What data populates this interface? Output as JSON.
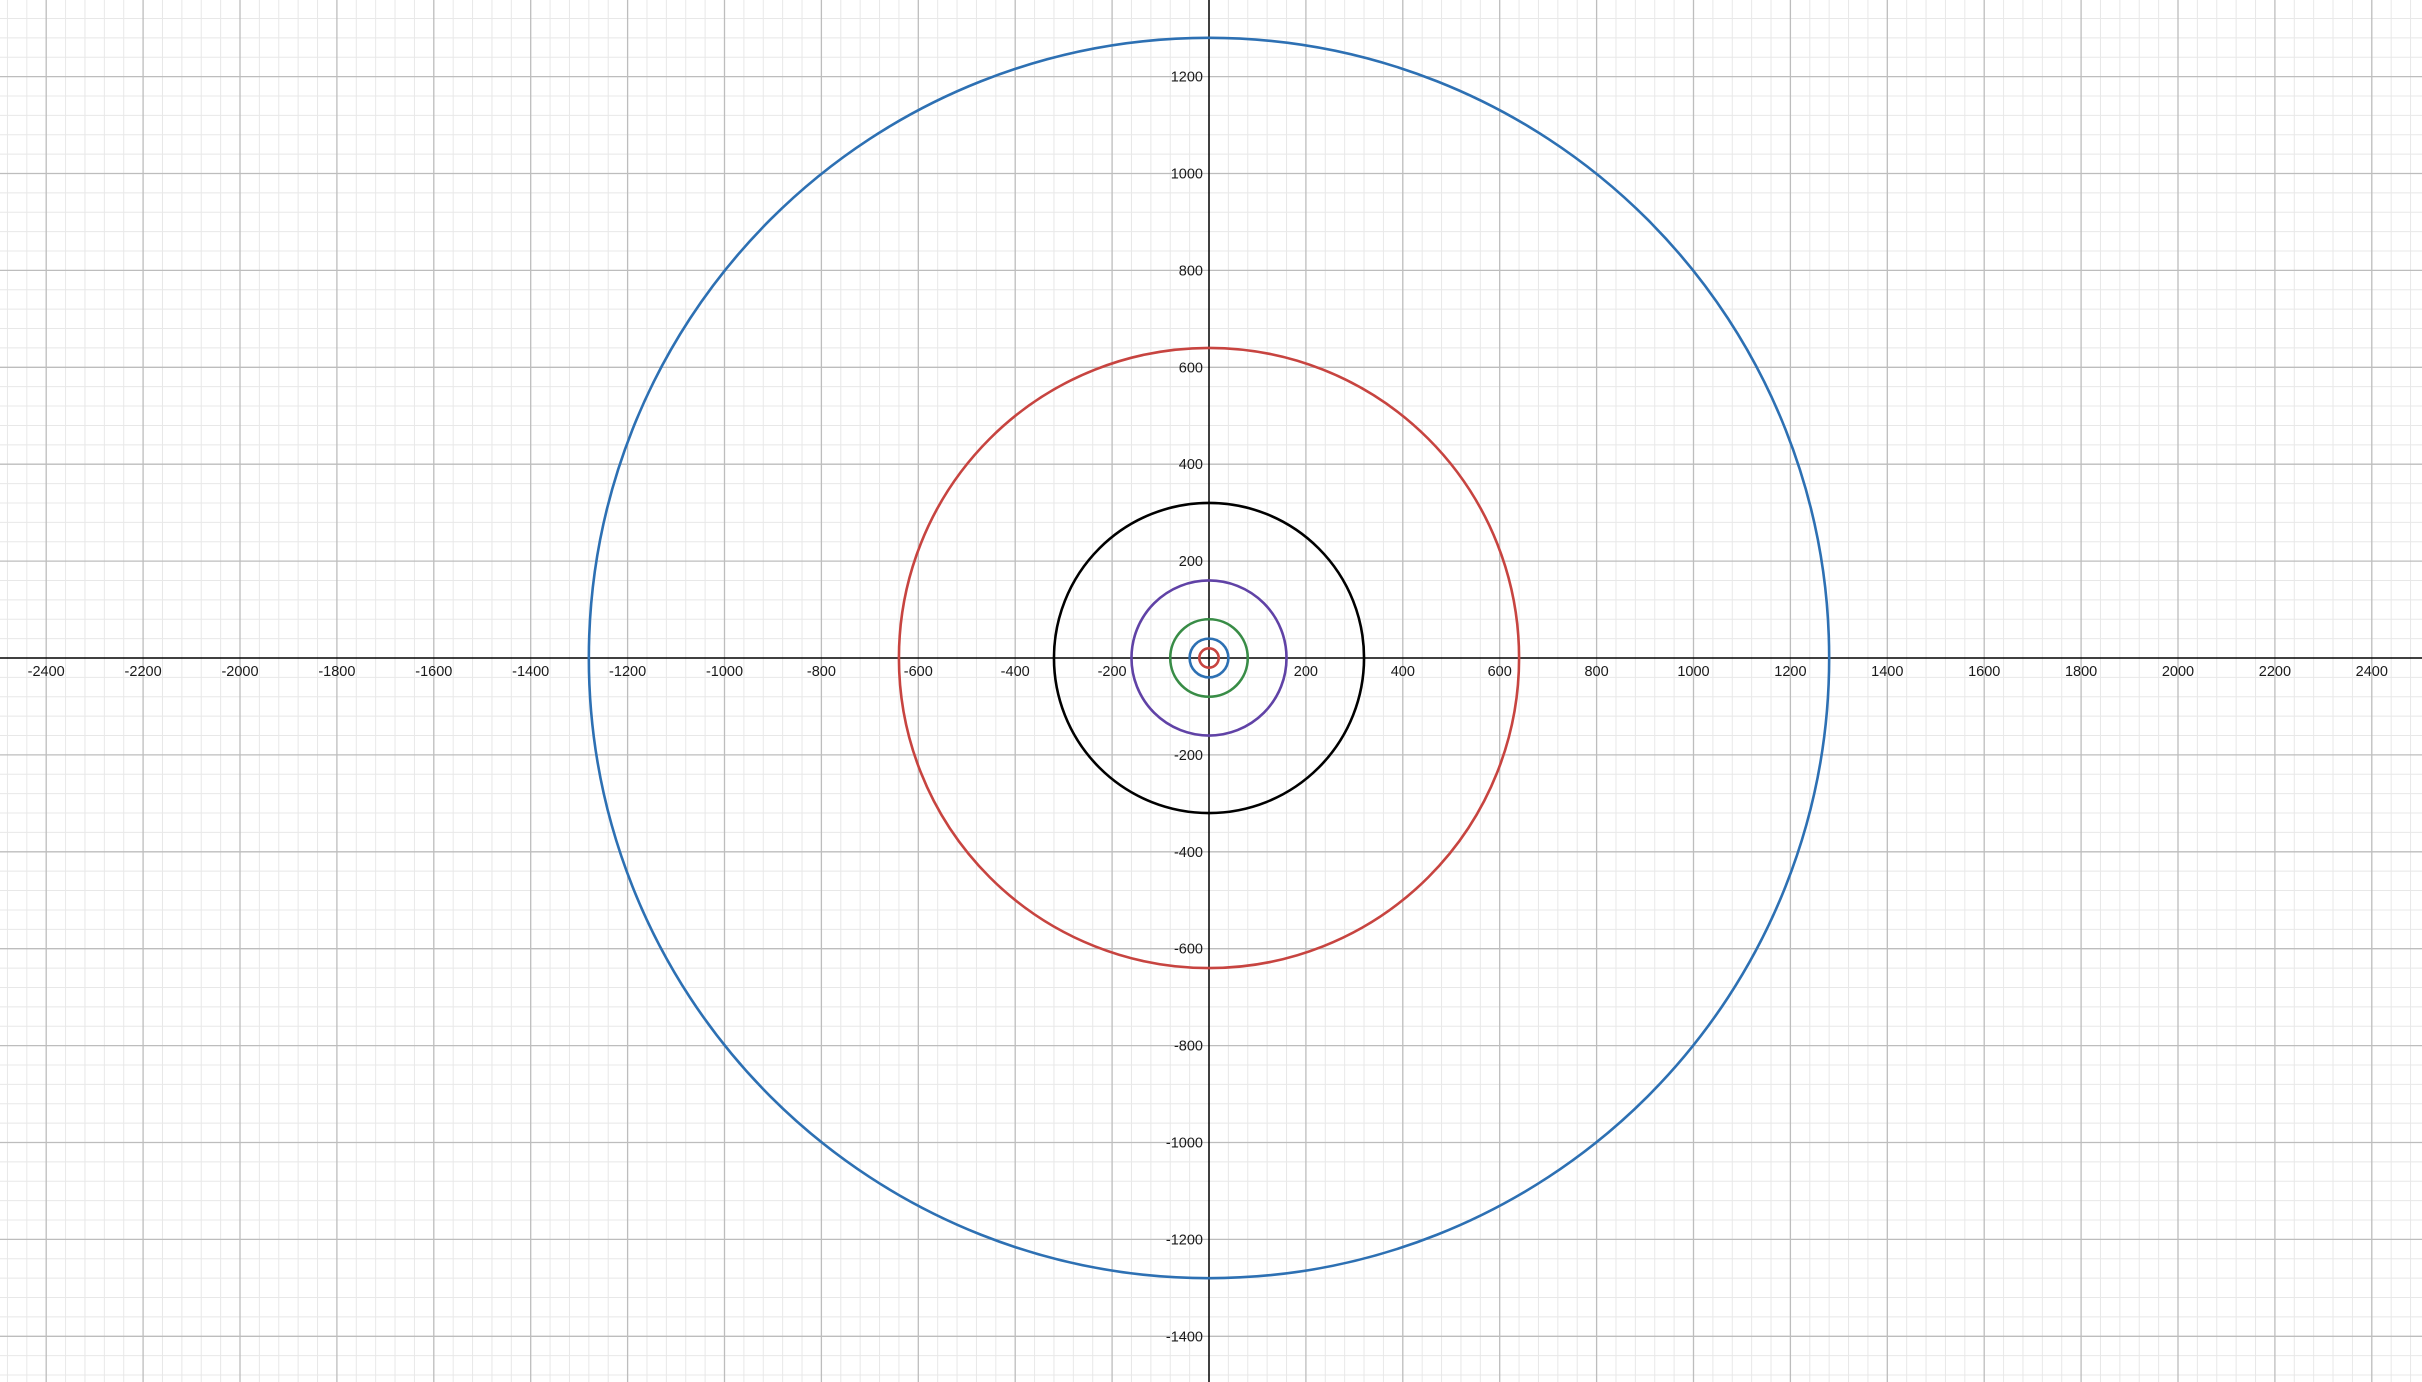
{
  "chart_data": {
    "type": "scatter",
    "title": "",
    "xlabel": "",
    "ylabel": "",
    "xlim": [
      -2500,
      2500
    ],
    "ylim": [
      -1490,
      1360
    ],
    "grid": true,
    "minor_grid": true,
    "legend": "none",
    "x_ticks": [
      -2400,
      -2200,
      -2000,
      -1800,
      -1600,
      -1400,
      -1200,
      -1000,
      -800,
      -600,
      -400,
      -200,
      200,
      400,
      600,
      800,
      1000,
      1200,
      1400,
      1600,
      1800,
      2000,
      2200,
      2400
    ],
    "x_tick_labels": [
      "-2400",
      "-2200",
      "-2000",
      "-1800",
      "-1600",
      "-1400",
      "-1200",
      "-1000",
      "-800",
      "-600",
      "-400",
      "-200",
      "200",
      "400",
      "600",
      "800",
      "1000",
      "1200",
      "1400",
      "1600",
      "1800",
      "2000",
      "2200",
      "2400"
    ],
    "y_ticks": [
      1200,
      1000,
      800,
      600,
      400,
      200,
      -200,
      -400,
      -600,
      -800,
      -1000,
      -1200,
      -1400
    ],
    "y_tick_labels": [
      "1200",
      "1000",
      "800",
      "600",
      "400",
      "200",
      "-200",
      "-400",
      "-600",
      "-800",
      "-1000",
      "-1200",
      "-1400"
    ],
    "circles": [
      {
        "cx": 0,
        "cy": 0,
        "r": 1280,
        "color": "#2d70b3"
      },
      {
        "cx": 0,
        "cy": 0,
        "r": 640,
        "color": "#c74440"
      },
      {
        "cx": 0,
        "cy": 0,
        "r": 320,
        "color": "#000000"
      },
      {
        "cx": 0,
        "cy": 0,
        "r": 160,
        "color": "#6042a6"
      },
      {
        "cx": 0,
        "cy": 0,
        "r": 80,
        "color": "#388c46"
      },
      {
        "cx": 0,
        "cy": 0,
        "r": 40,
        "color": "#2d70b3"
      },
      {
        "cx": 0,
        "cy": 0,
        "r": 20,
        "color": "#c74440"
      }
    ]
  },
  "colors": {
    "background": "#ffffff",
    "axis": "#000000",
    "major_grid": "#bdbdbd",
    "minor_grid": "#e8e8e8"
  }
}
